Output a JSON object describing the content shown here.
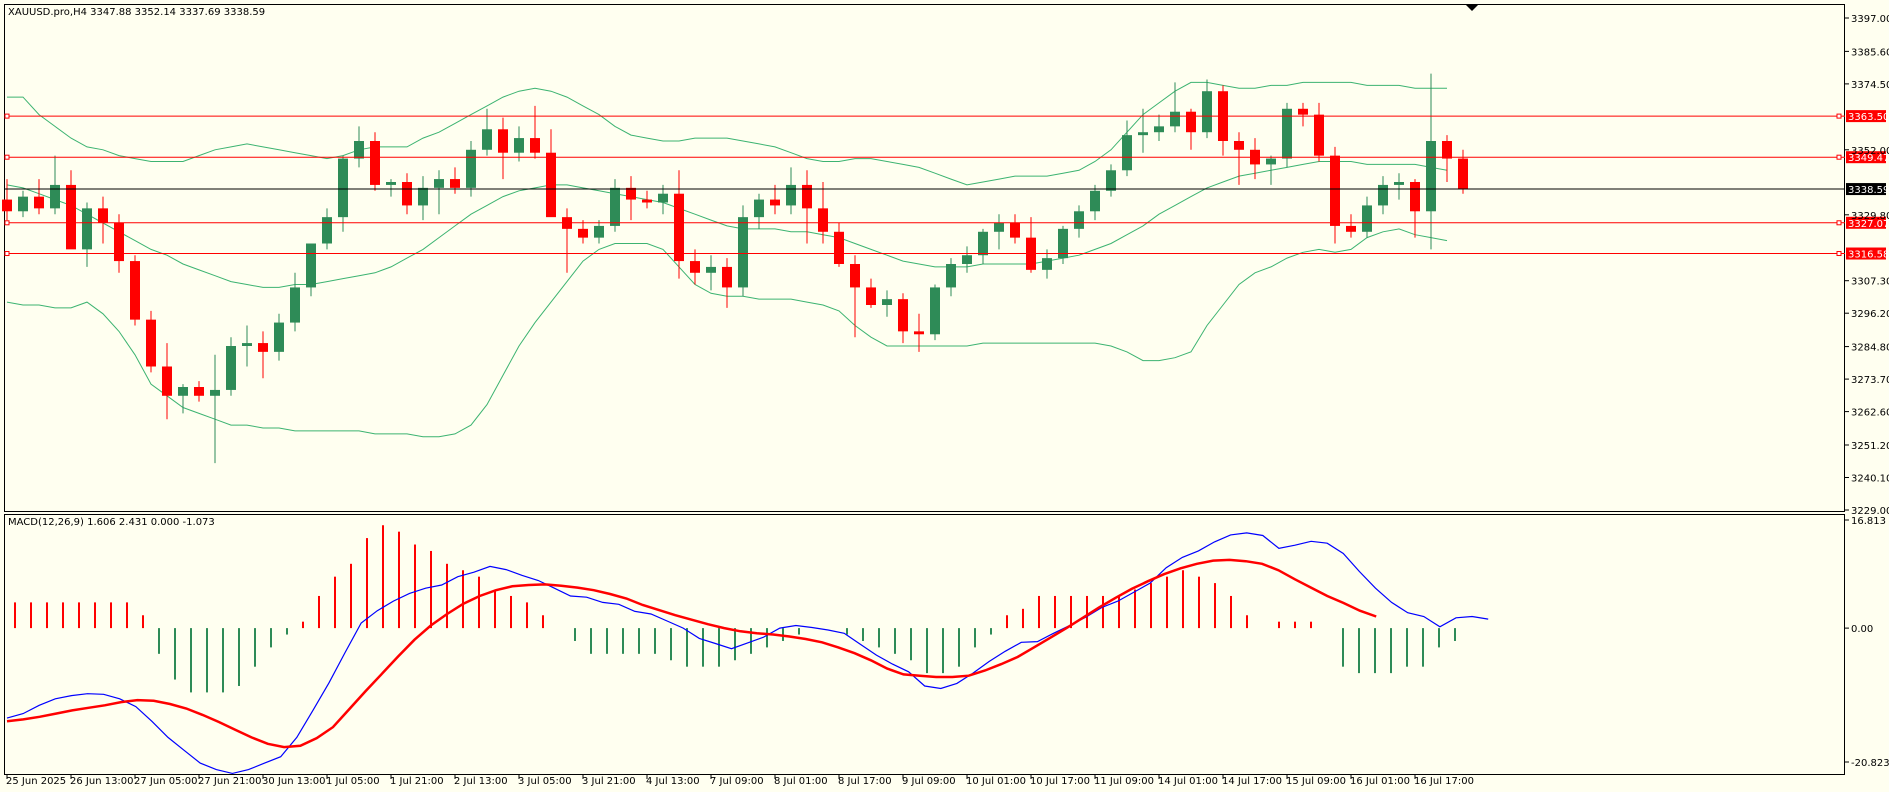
{
  "colors": {
    "background": "#fffff0",
    "bull": "#2e8b57",
    "bear": "#ff0000",
    "bands": "#3cb371",
    "hlines": "#ff0000",
    "macd_line": "#0000ff",
    "macd_signal": "#ff0000"
  },
  "icons": {
    "scroll_marker": "triangle-down-icon"
  },
  "main": {
    "title": "XAUUSD.pro,H4  3347.88 3352.14 3337.69 3338.59",
    "price_levels": [
      {
        "value": 3363.5,
        "label": "3363.50"
      },
      {
        "value": 3349.47,
        "label": "3349.47"
      },
      {
        "value": 3327.07,
        "label": "3327.07"
      },
      {
        "value": 3316.58,
        "label": "3316.58"
      }
    ],
    "current_price": {
      "value": 3338.59,
      "label": "3338.59"
    }
  },
  "macd": {
    "title": "MACD(12,26,9) 1.606 2.431 0.000 -1.073"
  },
  "chart_data": [
    {
      "type": "candlestick",
      "title": "XAUUSD.pro,H4",
      "ylim": [
        3229.0,
        3397.0
      ],
      "y_ticks": [
        "3397.00",
        "3385.60",
        "3374.50",
        "3363.50",
        "3352.00",
        "3340.90",
        "3329.80",
        "3318.40",
        "3307.30",
        "3296.20",
        "3284.80",
        "3273.70",
        "3262.60",
        "3251.20",
        "3240.10",
        "3229.00"
      ],
      "x_ticks": [
        "25 Jun 2025",
        "26 Jun 13:00",
        "27 Jun 05:00",
        "27 Jun 21:00",
        "30 Jun 13:00",
        "1 Jul 05:00",
        "1 Jul 21:00",
        "2 Jul 13:00",
        "3 Jul 05:00",
        "3 Jul 21:00",
        "4 Jul 13:00",
        "7 Jul 09:00",
        "8 Jul 01:00",
        "8 Jul 17:00",
        "9 Jul 09:00",
        "10 Jul 01:00",
        "10 Jul 17:00",
        "11 Jul 09:00",
        "14 Jul 01:00",
        "14 Jul 17:00",
        "15 Jul 09:00",
        "16 Jul 01:00",
        "16 Jul 17:00"
      ],
      "ohlc": [
        [
          3335,
          3342,
          3328,
          3331
        ],
        [
          3331,
          3338,
          3329,
          3336
        ],
        [
          3336,
          3342,
          3330,
          3332
        ],
        [
          3332,
          3350,
          3330,
          3340
        ],
        [
          3340,
          3345,
          3325,
          3318
        ],
        [
          3318,
          3334,
          3312,
          3332
        ],
        [
          3332,
          3336,
          3320,
          3327
        ],
        [
          3327,
          3330,
          3310,
          3314
        ],
        [
          3314,
          3316,
          3292,
          3294
        ],
        [
          3294,
          3297,
          3276,
          3278
        ],
        [
          3278,
          3286,
          3260,
          3268
        ],
        [
          3268,
          3272,
          3262,
          3271
        ],
        [
          3271,
          3273,
          3266,
          3268
        ],
        [
          3268,
          3282,
          3245,
          3270
        ],
        [
          3270,
          3288,
          3268,
          3285
        ],
        [
          3285,
          3292,
          3278,
          3286
        ],
        [
          3286,
          3290,
          3274,
          3283
        ],
        [
          3283,
          3296,
          3280,
          3293
        ],
        [
          3293,
          3310,
          3290,
          3305
        ],
        [
          3305,
          3320,
          3302,
          3320
        ],
        [
          3320,
          3332,
          3318,
          3329
        ],
        [
          3329,
          3350,
          3324,
          3349
        ],
        [
          3349,
          3360,
          3346,
          3355
        ],
        [
          3355,
          3358,
          3338,
          3340
        ],
        [
          3340,
          3342,
          3336,
          3341
        ],
        [
          3341,
          3344,
          3330,
          3333
        ],
        [
          3333,
          3343,
          3328,
          3339
        ],
        [
          3339,
          3345,
          3330,
          3342
        ],
        [
          3342,
          3346,
          3337,
          3339
        ],
        [
          3339,
          3355,
          3336,
          3352
        ],
        [
          3352,
          3366,
          3350,
          3359
        ],
        [
          3359,
          3363,
          3342,
          3351
        ],
        [
          3351,
          3360,
          3348,
          3356
        ],
        [
          3356,
          3367,
          3349,
          3351
        ],
        [
          3351,
          3359,
          3336,
          3329
        ],
        [
          3329,
          3332,
          3310,
          3325
        ],
        [
          3325,
          3328,
          3320,
          3322
        ],
        [
          3322,
          3328,
          3320,
          3326
        ],
        [
          3326,
          3342,
          3324,
          3339
        ],
        [
          3339,
          3343,
          3328,
          3335
        ],
        [
          3335,
          3338,
          3332,
          3334
        ],
        [
          3334,
          3340,
          3330,
          3337
        ],
        [
          3337,
          3345,
          3308,
          3314
        ],
        [
          3314,
          3318,
          3306,
          3310
        ],
        [
          3310,
          3316,
          3304,
          3312
        ],
        [
          3312,
          3315,
          3298,
          3305
        ],
        [
          3305,
          3333,
          3302,
          3329
        ],
        [
          3329,
          3337,
          3325,
          3335
        ],
        [
          3335,
          3340,
          3330,
          3333
        ],
        [
          3333,
          3346,
          3330,
          3340
        ],
        [
          3340,
          3345,
          3320,
          3332
        ],
        [
          3332,
          3341,
          3320,
          3324
        ],
        [
          3324,
          3327,
          3312,
          3313
        ],
        [
          3313,
          3316,
          3288,
          3305
        ],
        [
          3305,
          3308,
          3298,
          3299
        ],
        [
          3299,
          3304,
          3295,
          3301
        ],
        [
          3301,
          3303,
          3286,
          3290
        ],
        [
          3290,
          3296,
          3283,
          3289
        ],
        [
          3289,
          3306,
          3287,
          3305
        ],
        [
          3305,
          3315,
          3302,
          3313
        ],
        [
          3313,
          3319,
          3310,
          3316
        ],
        [
          3316,
          3325,
          3313,
          3324
        ],
        [
          3324,
          3330,
          3318,
          3327
        ],
        [
          3327,
          3330,
          3320,
          3322
        ],
        [
          3322,
          3329,
          3310,
          3311
        ],
        [
          3311,
          3318,
          3308,
          3315
        ],
        [
          3315,
          3326,
          3313,
          3325
        ],
        [
          3325,
          3333,
          3322,
          3331
        ],
        [
          3331,
          3340,
          3328,
          3338
        ],
        [
          3338,
          3347,
          3336,
          3345
        ],
        [
          3345,
          3362,
          3343,
          3357
        ],
        [
          3357,
          3366,
          3351,
          3358
        ],
        [
          3358,
          3364,
          3355,
          3360
        ],
        [
          3360,
          3375,
          3358,
          3365
        ],
        [
          3365,
          3366,
          3352,
          3358
        ],
        [
          3358,
          3376,
          3356,
          3372
        ],
        [
          3372,
          3374,
          3350,
          3355
        ],
        [
          3355,
          3358,
          3340,
          3352
        ],
        [
          3352,
          3356,
          3342,
          3347
        ],
        [
          3347,
          3350,
          3340,
          3349
        ],
        [
          3349,
          3368,
          3346,
          3366
        ],
        [
          3366,
          3368,
          3360,
          3364
        ],
        [
          3364,
          3368,
          3348,
          3350
        ],
        [
          3350,
          3353,
          3320,
          3326
        ],
        [
          3326,
          3330,
          3322,
          3324
        ],
        [
          3324,
          3336,
          3322,
          3333
        ],
        [
          3333,
          3343,
          3330,
          3340
        ],
        [
          3340,
          3344,
          3335,
          3341
        ],
        [
          3341,
          3342,
          3322,
          3331
        ],
        [
          3331,
          3378,
          3318,
          3355
        ],
        [
          3355,
          3357,
          3341,
          3349
        ],
        [
          3349,
          3352,
          3337,
          3338.59
        ]
      ],
      "bollinger": {
        "upper": [
          3370,
          3370,
          3364,
          3360,
          3356,
          3353,
          3352,
          3350,
          3349,
          3348,
          3348,
          3348,
          3350,
          3352,
          3353,
          3354,
          3353,
          3352,
          3351,
          3350,
          3349,
          3350,
          3352,
          3353,
          3353,
          3353,
          3356,
          3358,
          3361,
          3364,
          3367,
          3370,
          3372,
          3373,
          3372,
          3370,
          3367,
          3364,
          3360,
          3357,
          3356,
          3355,
          3355,
          3356,
          3356,
          3356,
          3355,
          3354,
          3353,
          3351,
          3349,
          3348,
          3348,
          3349,
          3349,
          3348,
          3347,
          3346,
          3344,
          3342,
          3340,
          3341,
          3342,
          3343,
          3343,
          3343,
          3344,
          3345,
          3348,
          3352,
          3358,
          3364,
          3368,
          3372,
          3375,
          3375,
          3374,
          3373,
          3373,
          3374,
          3374,
          3375,
          3375,
          3375,
          3375,
          3374,
          3374,
          3374,
          3373,
          3373,
          3373
        ],
        "middle": [
          3340,
          3339,
          3337,
          3335,
          3333,
          3330,
          3327,
          3324,
          3321,
          3318,
          3316,
          3313,
          3311,
          3309,
          3307,
          3306,
          3305,
          3305,
          3306,
          3306,
          3307,
          3308,
          3309,
          3310,
          3312,
          3315,
          3318,
          3322,
          3326,
          3330,
          3333,
          3336,
          3338,
          3339,
          3340,
          3340,
          3339,
          3338,
          3337,
          3336,
          3335,
          3334,
          3332,
          3330,
          3328,
          3326,
          3325,
          3325,
          3325,
          3324,
          3324,
          3323,
          3322,
          3320,
          3318,
          3316,
          3314,
          3313,
          3312,
          3312,
          3312,
          3313,
          3313,
          3313,
          3313,
          3314,
          3315,
          3316,
          3318,
          3320,
          3323,
          3326,
          3330,
          3333,
          3336,
          3339,
          3341,
          3343,
          3344,
          3345,
          3346,
          3347,
          3348,
          3348,
          3348,
          3347,
          3347,
          3347,
          3347,
          3346,
          3345
        ],
        "lower": [
          3300,
          3299,
          3299,
          3298,
          3298,
          3300,
          3296,
          3290,
          3282,
          3272,
          3268,
          3264,
          3262,
          3260,
          3258,
          3258,
          3257,
          3257,
          3256,
          3256,
          3256,
          3256,
          3256,
          3255,
          3255,
          3255,
          3254,
          3254,
          3255,
          3258,
          3265,
          3275,
          3285,
          3293,
          3300,
          3307,
          3314,
          3318,
          3320,
          3320,
          3320,
          3318,
          3312,
          3306,
          3303,
          3302,
          3302,
          3301,
          3301,
          3301,
          3300,
          3299,
          3297,
          3292,
          3288,
          3285,
          3285,
          3285,
          3285,
          3285,
          3285,
          3286,
          3286,
          3286,
          3286,
          3286,
          3286,
          3286,
          3286,
          3285,
          3283,
          3280,
          3280,
          3281,
          3283,
          3292,
          3299,
          3306,
          3310,
          3312,
          3315,
          3317,
          3318,
          3317,
          3318,
          3322,
          3324,
          3325,
          3323,
          3322,
          3321
        ]
      }
    },
    {
      "type": "bar",
      "title": "MACD(12,26,9)",
      "ylim": [
        -20.823,
        16.813
      ],
      "y_ticks": [
        "16.813",
        "0.00",
        "-20.823"
      ],
      "series": [
        {
          "name": "MACD",
          "values": [
            4,
            4,
            4,
            4,
            4,
            4,
            4,
            4,
            2,
            -4,
            -8,
            -10,
            -10,
            -10,
            -9,
            -6,
            -3,
            -1,
            1,
            5,
            8,
            10,
            14,
            16,
            15,
            13,
            12,
            10,
            9,
            8,
            6,
            5,
            4,
            2,
            0,
            -2,
            -4,
            -4,
            -4,
            -4,
            -4,
            -5,
            -6,
            -6,
            -6,
            -5,
            -4,
            -3,
            -2,
            -1,
            0,
            0,
            -1,
            -2,
            -3,
            -4,
            -5,
            -7,
            -7,
            -6,
            -3,
            -1,
            2,
            3,
            5,
            5,
            5,
            5,
            5,
            5,
            6,
            7,
            8,
            9,
            8,
            7,
            5,
            2,
            0,
            1,
            1,
            1,
            0,
            -6,
            -7,
            -7,
            -7,
            -6,
            -6,
            -3,
            -2
          ]
        },
        {
          "name": "Signal",
          "values": [
            -14.5,
            -14.2,
            -13.8,
            -13.3,
            -12.8,
            -12.4,
            -12,
            -11.5,
            -11.2,
            -11.3,
            -11.8,
            -12.5,
            -13.5,
            -14.6,
            -15.8,
            -17,
            -18,
            -18.5,
            -18.3,
            -17.1,
            -15.4,
            -12.6,
            -9.8,
            -7.1,
            -4.4,
            -1.8,
            0.4,
            2.2,
            3.8,
            5,
            5.9,
            6.5,
            6.7,
            6.8,
            6.6,
            6.3,
            5.9,
            5.3,
            4.6,
            3.6,
            2.8,
            2,
            1.3,
            0.6,
            0,
            -0.5,
            -0.8,
            -1,
            -1.3,
            -1.7,
            -2.2,
            -3,
            -3.9,
            -5,
            -6.3,
            -7.2,
            -7.4,
            -7.6,
            -7.6,
            -7.4,
            -6.6,
            -5.6,
            -4.5,
            -3,
            -1.5,
            0,
            1.6,
            3.2,
            4.7,
            6.1,
            7.3,
            8.4,
            9.3,
            10,
            10.5,
            10.6,
            10.4,
            10,
            9,
            7.6,
            6.3,
            5,
            3.9,
            2.7,
            1.8
          ]
        },
        {
          "name": "MACD_line",
          "values": [
            -14,
            -13.3,
            -12,
            -11,
            -10.5,
            -10.2,
            -10.3,
            -11,
            -12.2,
            -14.5,
            -17,
            -19,
            -21,
            -22,
            -22.6,
            -22,
            -21,
            -20,
            -17,
            -12.8,
            -8.5,
            -3.8,
            0.8,
            2.7,
            4.2,
            5.4,
            6.2,
            6.7,
            8,
            8.7,
            9.6,
            9.1,
            8.2,
            7.4,
            6.2,
            5,
            4.8,
            4,
            3.7,
            2.6,
            2.2,
            1.1,
            0,
            -1.6,
            -2.4,
            -3.2,
            -2.3,
            -1.4,
            0,
            0.4,
            0.1,
            -0.3,
            -0.8,
            -2.5,
            -4.2,
            -5.6,
            -6.8,
            -9,
            -9.4,
            -8.6,
            -7,
            -5.2,
            -3.6,
            -2.2,
            -2.1,
            -0.8,
            0.4,
            1.7,
            3.2,
            4.2,
            5.6,
            7,
            9.4,
            11,
            12,
            13.4,
            14.5,
            14.8,
            14.4,
            12.4,
            12.9,
            13.5,
            13.2,
            11.6,
            8.8,
            6.2,
            4,
            2.4,
            1.8,
            0.2,
            1.6,
            1.8,
            1.4
          ]
        }
      ]
    }
  ]
}
